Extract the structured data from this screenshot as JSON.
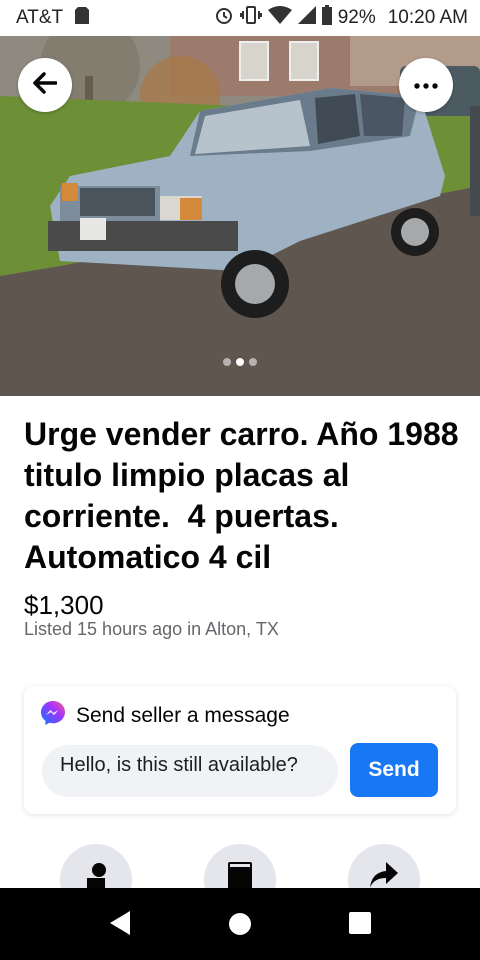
{
  "status_bar": {
    "carrier": "AT&T",
    "battery": "92%",
    "time": "10:20 AM",
    "icons": [
      "sim-card-icon",
      "alarm-icon",
      "vibrate-icon",
      "wifi-icon",
      "signal-icon",
      "battery-icon"
    ]
  },
  "photo": {
    "description_icon": "car-photo",
    "slide_count": 3,
    "active_slide": 2,
    "colors": {
      "sky": "#8a8f8a",
      "grass": "#6c8f3a",
      "road": "#5d554e",
      "car": "#9fb4c8"
    }
  },
  "listing": {
    "title": "Urge vender carro. Año 1988 titulo limpio placas al corriente.  4 puertas. Automatico 4 cil",
    "price": "$1,300",
    "listed": "Listed 15 hours ago in Alton, TX"
  },
  "message": {
    "header": "Send seller a message",
    "input_value": "Hello, is this still available?",
    "send_label": "Send"
  },
  "actions": [
    "message-seller-icon",
    "save-icon",
    "share-icon"
  ],
  "accent_color": "#1877f2"
}
